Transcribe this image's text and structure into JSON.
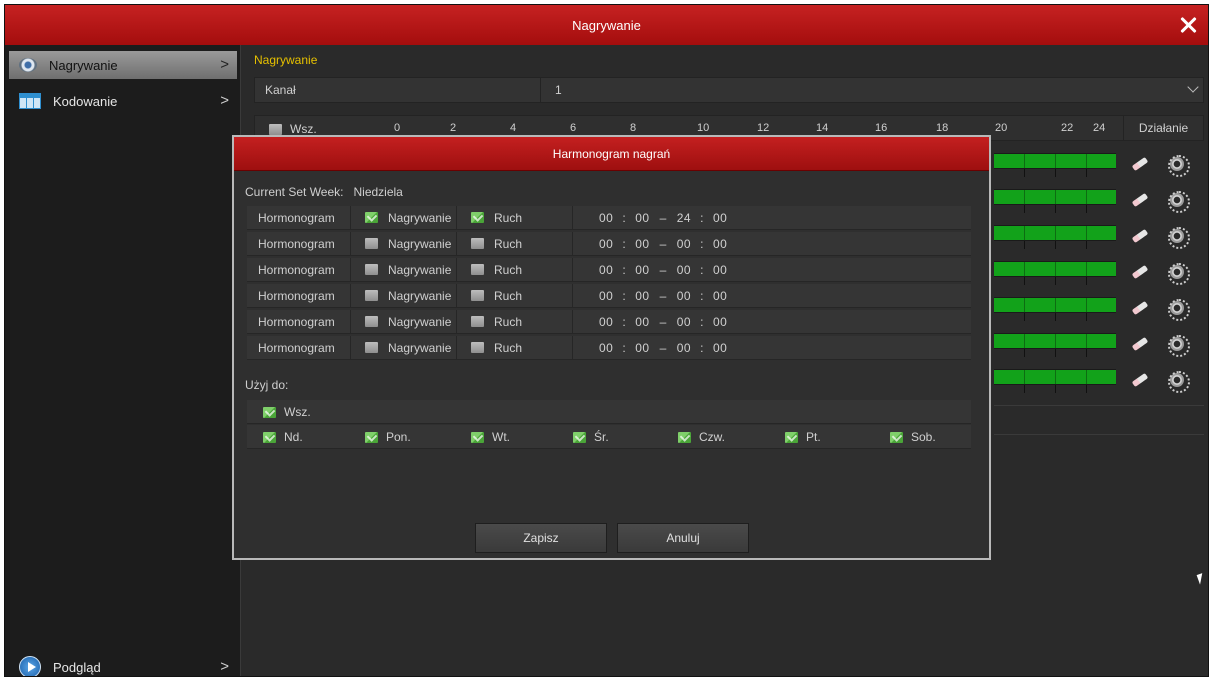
{
  "window": {
    "title": "Nagrywanie"
  },
  "sidebar": {
    "items": [
      {
        "label": "Nagrywanie",
        "icon": "record-camera-icon"
      },
      {
        "label": "Kodowanie",
        "icon": "encoding-grid-icon"
      }
    ],
    "bottom": {
      "label": "Podgląd",
      "icon": "play-icon"
    },
    "chevron": ">"
  },
  "main": {
    "section_title": "Nagrywanie",
    "channel": {
      "label": "Kanał",
      "value": "1"
    },
    "header": {
      "all_label": "Wsz.",
      "ticks": [
        "0",
        "2",
        "4",
        "6",
        "8",
        "10",
        "12",
        "14",
        "16",
        "18",
        "20",
        "22",
        "24"
      ],
      "action_label": "Działanie"
    }
  },
  "dialog": {
    "title": "Harmonogram nagrań",
    "week_label": "Current Set Week:",
    "week_value": "Niedziela",
    "rows": [
      {
        "label": "Hormonogram",
        "rec": "Nagrywanie",
        "rec_on": true,
        "motion": "Ruch",
        "motion_on": true,
        "start_h": "00",
        "start_m": "00",
        "end_h": "24",
        "end_m": "00"
      },
      {
        "label": "Hormonogram",
        "rec": "Nagrywanie",
        "rec_on": false,
        "motion": "Ruch",
        "motion_on": false,
        "start_h": "00",
        "start_m": "00",
        "end_h": "00",
        "end_m": "00"
      },
      {
        "label": "Hormonogram",
        "rec": "Nagrywanie",
        "rec_on": false,
        "motion": "Ruch",
        "motion_on": false,
        "start_h": "00",
        "start_m": "00",
        "end_h": "00",
        "end_m": "00"
      },
      {
        "label": "Hormonogram",
        "rec": "Nagrywanie",
        "rec_on": false,
        "motion": "Ruch",
        "motion_on": false,
        "start_h": "00",
        "start_m": "00",
        "end_h": "00",
        "end_m": "00"
      },
      {
        "label": "Hormonogram",
        "rec": "Nagrywanie",
        "rec_on": false,
        "motion": "Ruch",
        "motion_on": false,
        "start_h": "00",
        "start_m": "00",
        "end_h": "00",
        "end_m": "00"
      },
      {
        "label": "Hormonogram",
        "rec": "Nagrywanie",
        "rec_on": false,
        "motion": "Ruch",
        "motion_on": false,
        "start_h": "00",
        "start_m": "00",
        "end_h": "00",
        "end_m": "00"
      }
    ],
    "apply_label": "Użyj do:",
    "apply_all": "Wsz.",
    "days": [
      "Nd.",
      "Pon.",
      "Wt.",
      "Śr.",
      "Czw.",
      "Pt.",
      "Sob."
    ],
    "save_label": "Zapisz",
    "cancel_label": "Anuluj"
  },
  "colors": {
    "titlebar": "#b71616",
    "accent_title": "#e6c000",
    "schedule_green": "#12a21a"
  }
}
